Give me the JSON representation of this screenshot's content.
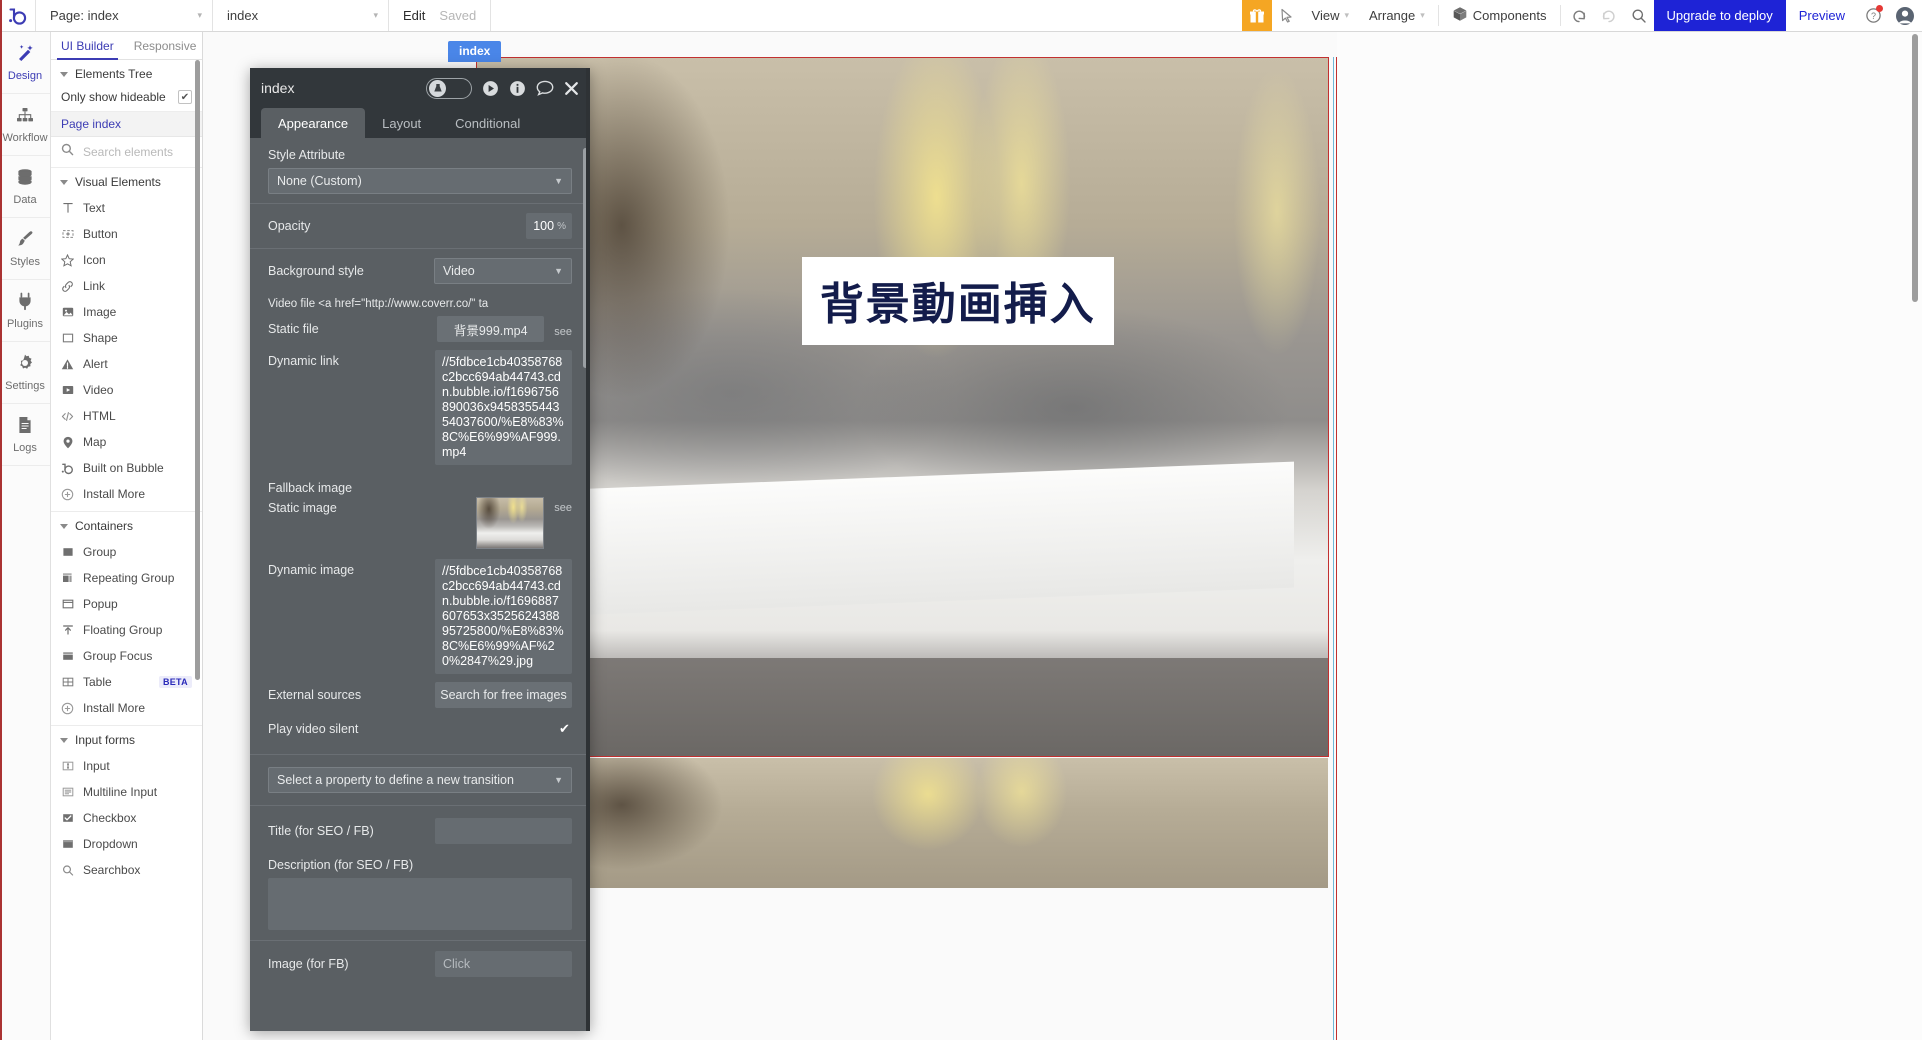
{
  "topbar": {
    "logo_icon": "bubble-logo-icon",
    "page_select": {
      "label": "Page: index",
      "caret": "▾"
    },
    "element_select": {
      "label": "index",
      "caret": "▾"
    },
    "edit_label": "Edit",
    "saved_label": "Saved",
    "gift_icon": "gift-icon",
    "cursor_icon": "cursor-arrow-icon",
    "view": {
      "label": "View",
      "caret": "▾"
    },
    "arrange": {
      "label": "Arrange",
      "caret": "▾"
    },
    "components": {
      "label": "Components",
      "icon": "cube-icon"
    },
    "undo_icon": "undo-icon",
    "redo_icon": "redo-icon",
    "search_icon": "search-icon",
    "upgrade_label": "Upgrade to deploy",
    "preview_label": "Preview",
    "help_icon": "help-question-icon",
    "avatar_icon": "user-avatar-icon"
  },
  "rail": {
    "items": [
      {
        "label": "Design",
        "icon": "design-wand-icon",
        "active": true
      },
      {
        "label": "Workflow",
        "icon": "workflow-nodes-icon",
        "active": false
      },
      {
        "label": "Data",
        "icon": "database-icon",
        "active": false
      },
      {
        "label": "Styles",
        "icon": "paintbrush-icon",
        "active": false
      },
      {
        "label": "Plugins",
        "icon": "plug-icon",
        "active": false
      },
      {
        "label": "Settings",
        "icon": "gear-icon",
        "active": false
      },
      {
        "label": "Logs",
        "icon": "document-icon",
        "active": false
      }
    ]
  },
  "elements_panel": {
    "tabs": [
      {
        "label": "UI Builder",
        "active": true
      },
      {
        "label": "Responsive",
        "active": false
      }
    ],
    "elements_tree_label": "Elements Tree",
    "only_show_hideable": {
      "label": "Only show hideable",
      "checked": true,
      "check_glyph": "✔"
    },
    "page_index_label": "Page index",
    "search": {
      "placeholder": "Search elements",
      "value": "",
      "icon": "search-icon"
    },
    "groups": [
      {
        "title": "Visual Elements",
        "items": [
          {
            "label": "Text",
            "icon": "text-t-icon",
            "badge": ""
          },
          {
            "label": "Button",
            "icon": "button-icon",
            "badge": ""
          },
          {
            "label": "Icon",
            "icon": "star-icon",
            "badge": ""
          },
          {
            "label": "Link",
            "icon": "link-chain-icon",
            "badge": ""
          },
          {
            "label": "Image",
            "icon": "image-icon",
            "badge": ""
          },
          {
            "label": "Shape",
            "icon": "square-icon",
            "badge": ""
          },
          {
            "label": "Alert",
            "icon": "alert-triangle-icon",
            "badge": ""
          },
          {
            "label": "Video",
            "icon": "video-play-icon",
            "badge": ""
          },
          {
            "label": "HTML",
            "icon": "code-icon",
            "badge": ""
          },
          {
            "label": "Map",
            "icon": "map-pin-icon",
            "badge": ""
          },
          {
            "label": "Built on Bubble",
            "icon": "bubble-logo-icon",
            "badge": ""
          },
          {
            "label": "Install More",
            "icon": "plus-circle-icon",
            "badge": ""
          }
        ]
      },
      {
        "title": "Containers",
        "items": [
          {
            "label": "Group",
            "icon": "group-square-icon",
            "badge": ""
          },
          {
            "label": "Repeating Group",
            "icon": "repeating-group-icon",
            "badge": ""
          },
          {
            "label": "Popup",
            "icon": "popup-icon",
            "badge": ""
          },
          {
            "label": "Floating Group",
            "icon": "floating-group-icon",
            "badge": ""
          },
          {
            "label": "Group Focus",
            "icon": "group-focus-icon",
            "badge": ""
          },
          {
            "label": "Table",
            "icon": "table-grid-icon",
            "badge": "BETA"
          },
          {
            "label": "Install More",
            "icon": "plus-circle-icon",
            "badge": ""
          }
        ]
      },
      {
        "title": "Input forms",
        "items": [
          {
            "label": "Input",
            "icon": "input-field-icon",
            "badge": ""
          },
          {
            "label": "Multiline Input",
            "icon": "multiline-icon",
            "badge": ""
          },
          {
            "label": "Checkbox",
            "icon": "checkbox-icon",
            "badge": ""
          },
          {
            "label": "Dropdown",
            "icon": "dropdown-icon",
            "badge": ""
          },
          {
            "label": "Searchbox",
            "icon": "searchbox-icon",
            "badge": ""
          }
        ]
      }
    ]
  },
  "canvas": {
    "page_tab_label": "index",
    "overlay_text": "背景動画挿入",
    "overlay_text_color": "#131c4b",
    "overlay_bg_color": "#ffffff",
    "selection_border_color": "#c23030"
  },
  "property_editor": {
    "title": "index",
    "header_icons": [
      {
        "name": "hide-toggle",
        "icon": "toggle-switch-icon"
      },
      {
        "name": "preview-play",
        "icon": "play-circle-icon"
      },
      {
        "name": "info",
        "icon": "info-circle-icon"
      },
      {
        "name": "comment",
        "icon": "comment-bubble-icon"
      },
      {
        "name": "close",
        "icon": "close-x-icon"
      }
    ],
    "tabs": [
      {
        "label": "Appearance",
        "active": true
      },
      {
        "label": "Layout",
        "active": false
      },
      {
        "label": "Conditional",
        "active": false
      }
    ],
    "fields": {
      "style_attribute_label": "Style Attribute",
      "style_attribute_value": "None (Custom)",
      "opacity_label": "Opacity",
      "opacity_value": "100",
      "opacity_unit": "%",
      "background_style_label": "Background style",
      "background_style_value": "Video",
      "video_file_note": "Video file <a href=\"http://www.coverr.co/\" ta",
      "static_file_label": "Static file",
      "static_file_value": "背景999.mp4",
      "static_file_see": "see",
      "dynamic_link_label": "Dynamic link",
      "dynamic_link_value": "//5fdbce1cb40358768c2bcc694ab44743.cdn.bubble.io/f1696756890036x945835544354037600/%E8%83%8C%E6%99%AF999.mp4",
      "fallback_image_label": "Fallback image",
      "static_image_label": "Static image",
      "static_image_see": "see",
      "static_image_thumb": "office-desks-thumbnail",
      "dynamic_image_label": "Dynamic image",
      "dynamic_image_value": "//5fdbce1cb40358768c2bcc694ab44743.cdn.bubble.io/f1696887607653x352562438895725800/%E8%83%8C%E6%99%AF%20%2847%29.jpg",
      "external_sources_label": "External sources",
      "external_sources_button": "Search for free images",
      "play_video_silent_label": "Play video silent",
      "play_video_silent_checked": true,
      "play_video_silent_glyph": "✔",
      "transition_select": "Select a property to define a new transition",
      "title_seo_label": "Title (for SEO / FB)",
      "title_seo_value": "",
      "description_seo_label": "Description (for SEO / FB)",
      "description_seo_value": "",
      "image_fb_label": "Image (for FB)",
      "image_fb_placeholder": "Click"
    }
  },
  "colors": {
    "accent_blue": "#3c3cb4",
    "upgrade_blue": "#1e23d6",
    "gift_orange": "#f5a623",
    "panel_dark": "#5a5f63",
    "panel_header_dark": "#32373b",
    "selection_red": "#c23030",
    "tab_blue": "#4a86e8"
  }
}
